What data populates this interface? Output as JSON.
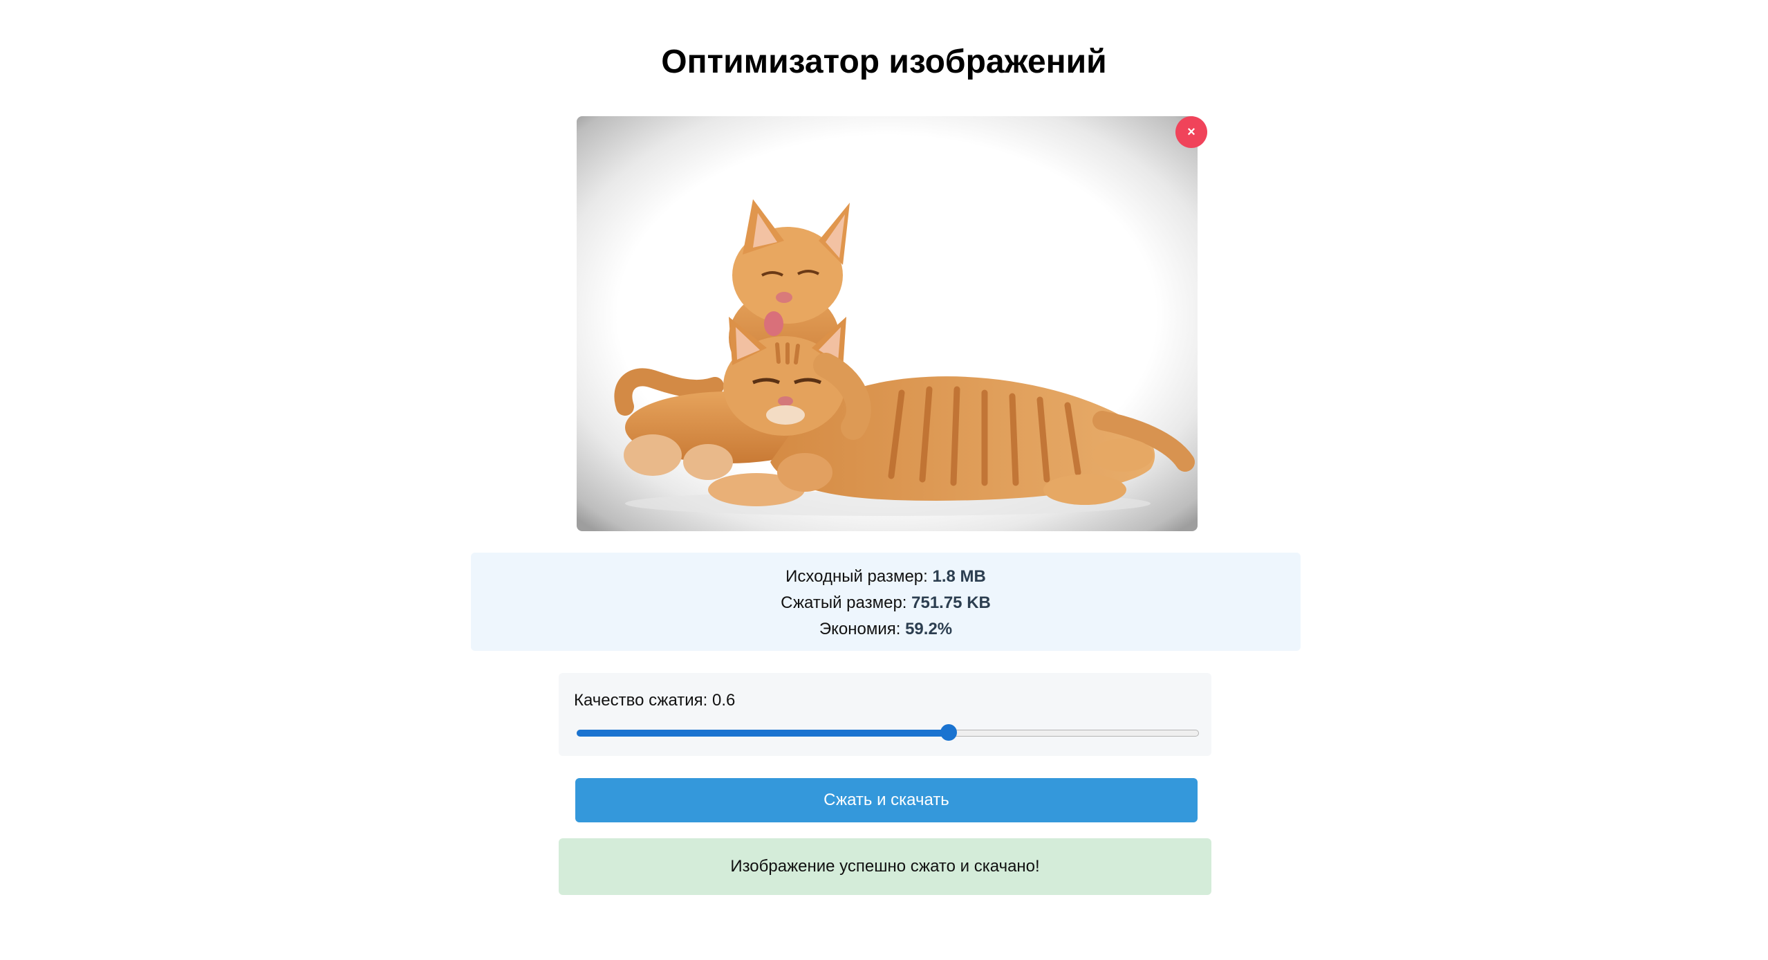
{
  "header": {
    "title": "Оптимизатор изображений"
  },
  "preview": {
    "image_description": "photo-two-orange-kittens",
    "remove_label": "×"
  },
  "stats": {
    "original_label": "Исходный размер:",
    "original_value": "1.8 MB",
    "compressed_label": "Сжатый размер:",
    "compressed_value": "751.75 KB",
    "savings_label": "Экономия:",
    "savings_value": "59.2%"
  },
  "quality": {
    "label": "Качество сжатия:",
    "value_text": "0.6",
    "value": 0.6,
    "min": 0,
    "max": 1
  },
  "action": {
    "button_label": "Сжать и скачать"
  },
  "status": {
    "message": "Изображение успешно сжато и скачано!"
  },
  "colors": {
    "accent": "#3498db",
    "slider": "#1a73d0",
    "remove": "#f0435a",
    "stats_bg": "#eef6fd",
    "success_bg": "#d4ecd9"
  }
}
